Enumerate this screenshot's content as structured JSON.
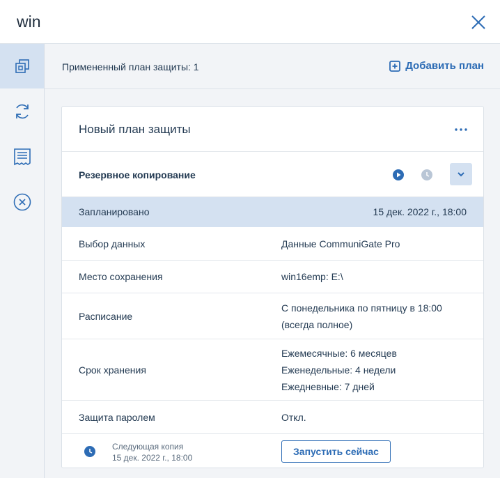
{
  "header": {
    "title": "win"
  },
  "sidebar": {
    "items": [
      {
        "name": "protection",
        "icon": "shield-copy-icon",
        "active": true
      },
      {
        "name": "sync",
        "icon": "sync-icon",
        "active": false
      },
      {
        "name": "activities",
        "icon": "document-list-icon",
        "active": false
      },
      {
        "name": "cancel",
        "icon": "close-circle-icon",
        "active": false
      }
    ]
  },
  "plan_bar": {
    "applied_text": "Примененный план защиты: 1",
    "add_label": "Добавить план"
  },
  "plan": {
    "name": "Новый план защиты",
    "module": {
      "title": "Резервное копирование"
    },
    "rows": [
      {
        "label": "Запланировано",
        "value": "15 дек. 2022 г., 18:00"
      },
      {
        "label": "Выбор данных",
        "value": "Данные CommuniGate Pro"
      },
      {
        "label": "Место сохранения",
        "value": "win16emp: E:\\"
      },
      {
        "label": "Расписание",
        "value_lines": [
          "С понедельника по пятницу в 18:00",
          "(всегда полное)"
        ]
      },
      {
        "label": "Срок хранения",
        "value_lines": [
          "Ежемесячные: 6 месяцев",
          "Еженедельные: 4 недели",
          "Ежедневные: 7 дней"
        ]
      },
      {
        "label": "Защита паролем",
        "value": "Откл."
      }
    ],
    "footer": {
      "next_label": "Следующая копия",
      "next_date": "15 дек. 2022 г., 18:00",
      "run_label": "Запустить сейчас"
    }
  },
  "colors": {
    "accent": "#2d6cb5",
    "selected_bg": "#d4e1f1",
    "panel_bg": "#f2f4f7",
    "text": "#243b53"
  }
}
